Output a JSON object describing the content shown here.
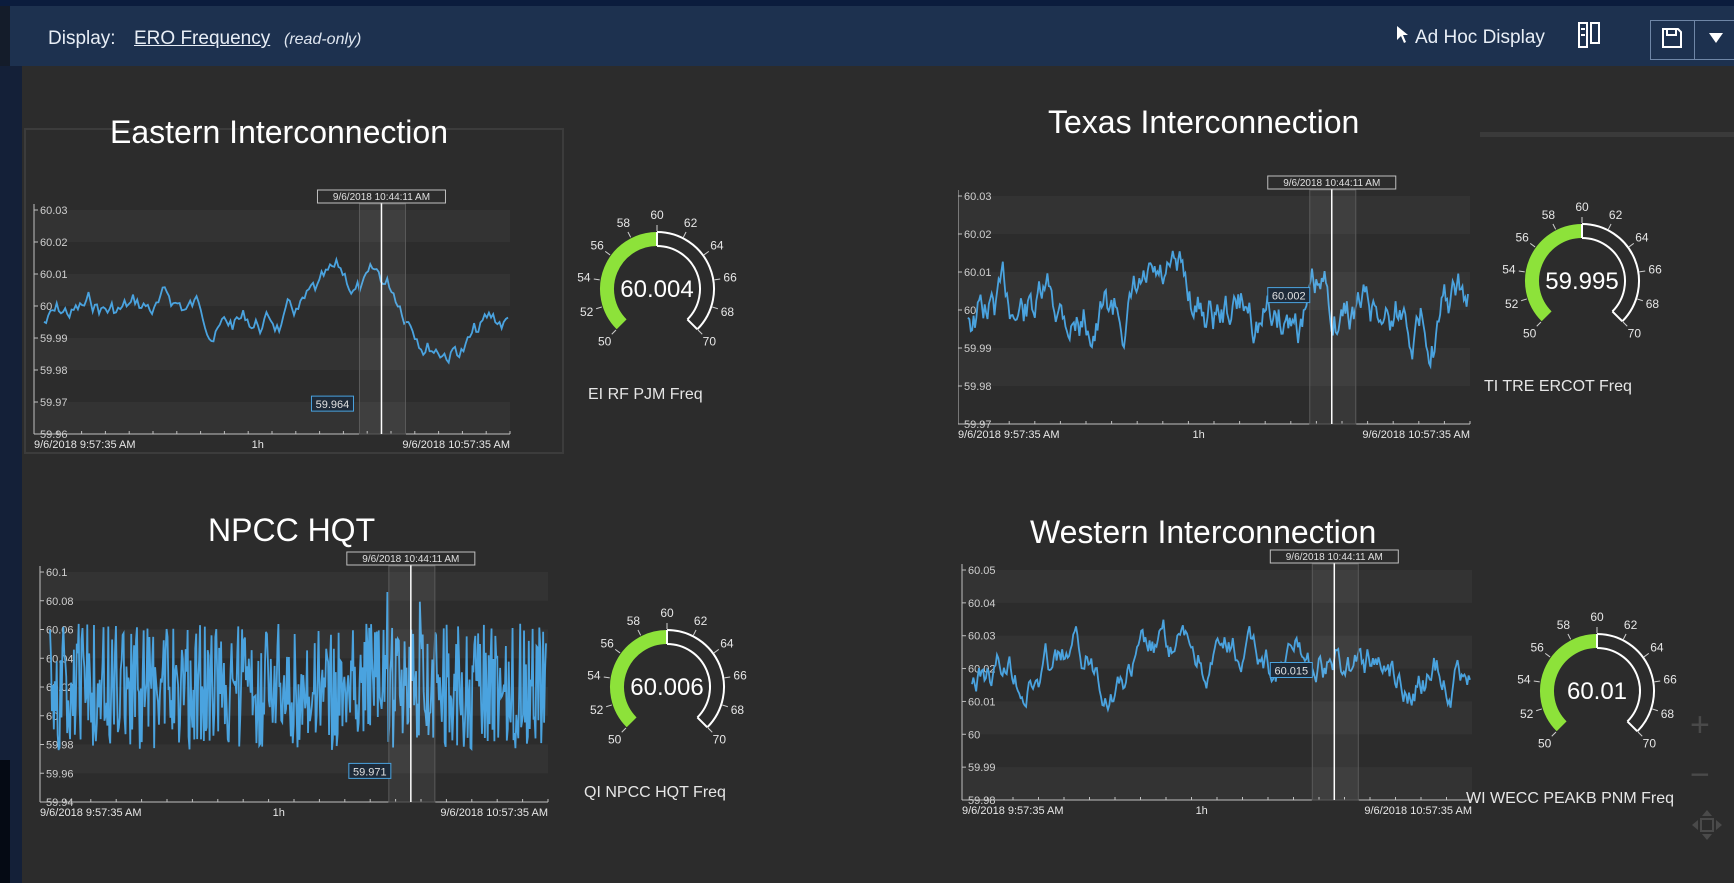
{
  "toolbar": {
    "display_label": "Display:",
    "display_name": "ERO Frequency",
    "read_only": "(read-only)",
    "adhoc_label": "Ad Hoc Display"
  },
  "colors": {
    "line": "#4aa3df",
    "gauge_fill": "#8de23a",
    "background": "#2c2c2c",
    "toolbar": "#1d314f"
  },
  "panels": [
    {
      "title": "Eastern Interconnection",
      "cursor_time": "9/6/2018 10:44:11 AM",
      "cursor_value": "59.964",
      "y_ticks": [
        "60.03",
        "60.02",
        "60.01",
        "60",
        "59.99",
        "59.98",
        "59.97",
        "59.96"
      ],
      "x_start": "9/6/2018 9:57:35 AM",
      "x_mid": "1h",
      "x_end": "9/6/2018 10:57:35 AM",
      "gauge_value": "60.004",
      "gauge_name": "EI RF PJM Freq",
      "gauge_ticks": [
        "50",
        "52",
        "54",
        "56",
        "58",
        "60",
        "62",
        "64",
        "66",
        "68",
        "70"
      ]
    },
    {
      "title": "Texas Interconnection",
      "cursor_time": "9/6/2018 10:44:11 AM",
      "cursor_value": "60.002",
      "y_ticks": [
        "60.03",
        "60.02",
        "60.01",
        "60",
        "59.99",
        "59.98",
        "59.97"
      ],
      "x_start": "9/6/2018 9:57:35 AM",
      "x_mid": "1h",
      "x_end": "9/6/2018 10:57:35 AM",
      "gauge_value": "59.995",
      "gauge_name": "TI TRE ERCOT Freq",
      "gauge_ticks": [
        "50",
        "52",
        "54",
        "56",
        "58",
        "60",
        "62",
        "64",
        "66",
        "68",
        "70"
      ]
    },
    {
      "title": "NPCC HQT",
      "cursor_time": "9/6/2018 10:44:11 AM",
      "cursor_value": "59.971",
      "y_ticks": [
        "60.1",
        "60.08",
        "60.06",
        "60.04",
        "60.02",
        "60",
        "59.98",
        "59.96",
        "59.94"
      ],
      "x_start": "9/6/2018 9:57:35 AM",
      "x_mid": "1h",
      "x_end": "9/6/2018 10:57:35 AM",
      "gauge_value": "60.006",
      "gauge_name": "QI NPCC HQT Freq",
      "gauge_ticks": [
        "50",
        "52",
        "54",
        "56",
        "58",
        "60",
        "62",
        "64",
        "66",
        "68",
        "70"
      ]
    },
    {
      "title": "Western Interconnection",
      "cursor_time": "9/6/2018 10:44:11 AM",
      "cursor_value": "60.015",
      "y_ticks": [
        "60.05",
        "60.04",
        "60.03",
        "60.02",
        "60.01",
        "60",
        "59.99",
        "59.98"
      ],
      "x_start": "9/6/2018 9:57:35 AM",
      "x_mid": "1h",
      "x_end": "9/6/2018 10:57:35 AM",
      "gauge_value": "60.01",
      "gauge_name": "WI WECC PEAKB PNM Freq",
      "gauge_ticks": [
        "50",
        "52",
        "54",
        "56",
        "58",
        "60",
        "62",
        "64",
        "66",
        "68",
        "70"
      ]
    }
  ]
}
